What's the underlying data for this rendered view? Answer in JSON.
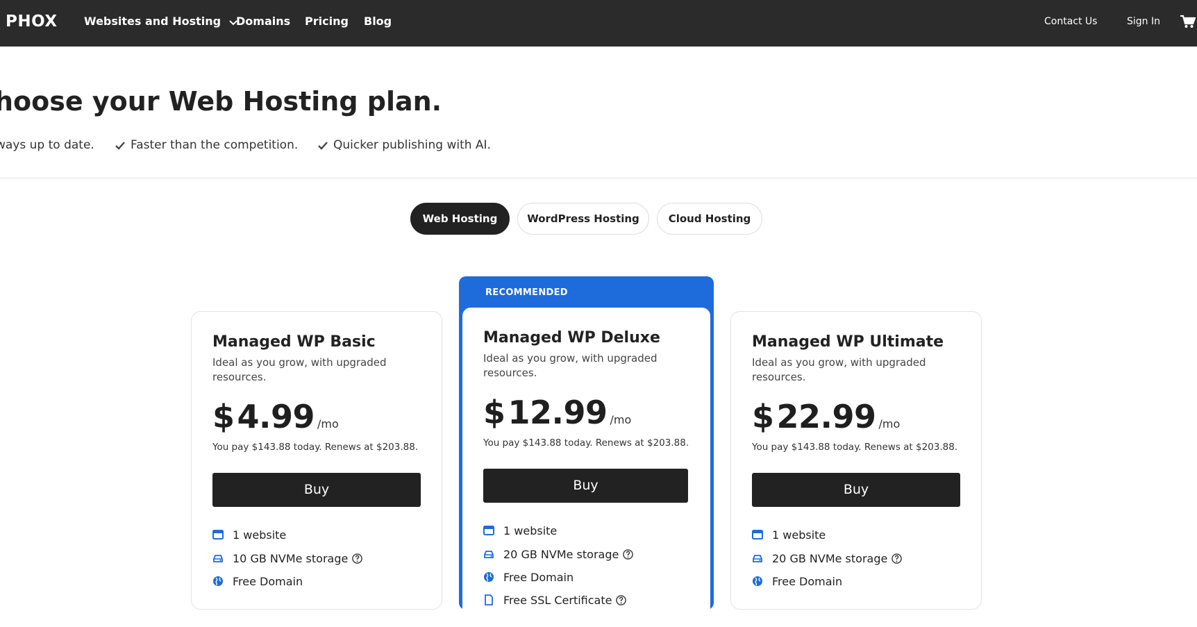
{
  "nav": {
    "brand": "PHOX",
    "items": [
      {
        "label": "Websites and Hosting"
      },
      {
        "label": "Domains"
      },
      {
        "label": "Pricing"
      },
      {
        "label": "Blog"
      }
    ],
    "contact": "Contact Us",
    "sign_in": "Sign In"
  },
  "hero": {
    "title": "hoose your Web Hosting plan.",
    "perks": [
      "ways up to date.",
      "Faster than the competition.",
      "Quicker publishing with AI."
    ]
  },
  "tabs": [
    {
      "label": "Web Hosting",
      "active": true
    },
    {
      "label": "WordPress Hosting",
      "active": false
    },
    {
      "label": "Cloud Hosting",
      "active": false
    }
  ],
  "recommended_label": "RECOMMENDED",
  "plans": [
    {
      "name": "Managed WP Basic",
      "desc": "Ideal as you grow, with upgraded resources.",
      "currency": "$",
      "price": "4.99",
      "per": "/mo",
      "note": "You pay $143.88 today. Renews at $203.88.",
      "buy": "Buy",
      "features": [
        "1 website",
        "10 GB NVMe storage",
        "Free Domain"
      ]
    },
    {
      "name": "Managed WP Deluxe",
      "desc": "Ideal as you grow, with upgraded resources.",
      "currency": "$",
      "price": "12.99",
      "per": "/mo",
      "note": "You pay $143.88 today. Renews at $203.88.",
      "buy": "Buy",
      "features": [
        "1 website",
        "20 GB NVMe storage",
        "Free Domain",
        "Free SSL Certificate"
      ]
    },
    {
      "name": "Managed WP Ultimate",
      "desc": "Ideal as you grow, with upgraded resources.",
      "currency": "$",
      "price": "22.99",
      "per": "/mo",
      "note": "You pay $143.88 today. Renews at $203.88.",
      "buy": "Buy",
      "features": [
        "1 website",
        "20 GB NVMe storage",
        "Free Domain"
      ]
    }
  ],
  "colors": {
    "accent": "#1e6bdc",
    "nav_bg": "#2b2b2b",
    "button_bg": "#222222"
  },
  "icons": {
    "website": "browser-window-icon",
    "storage": "hard-drive-icon",
    "domain": "globe-icon",
    "ssl": "certificate-icon",
    "help": "question-circle-icon",
    "cart": "cart-icon",
    "check": "check-icon",
    "chevron": "chevron-down-icon"
  }
}
